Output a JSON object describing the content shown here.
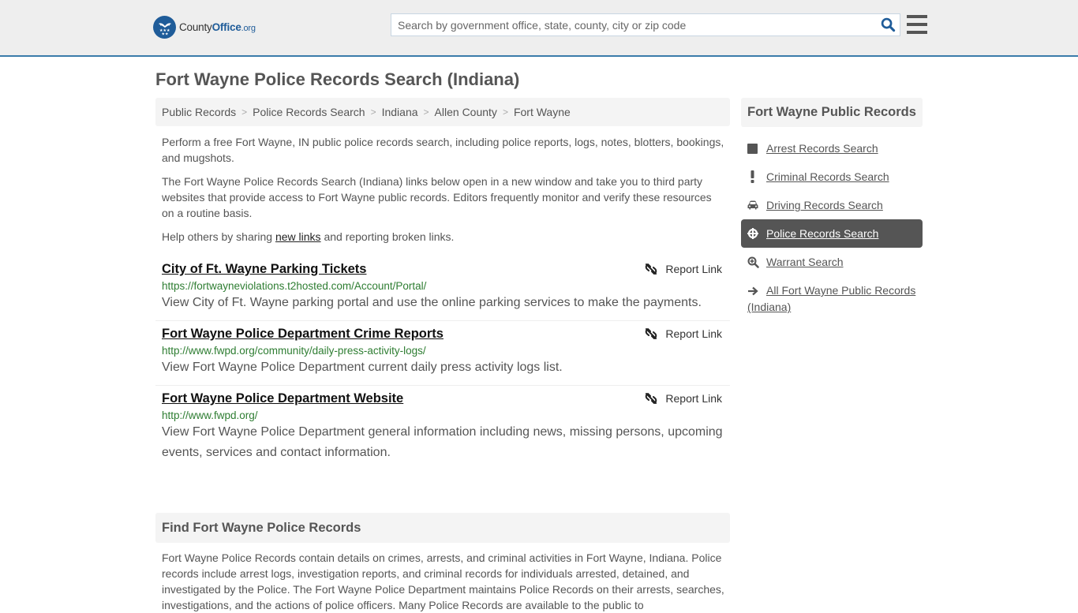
{
  "header": {
    "logo": {
      "name": "County",
      "name_accent": "Office",
      "tld": ".org",
      "brand_color": "#1f5c99"
    },
    "search": {
      "placeholder": "Search by government office, state, county, city or zip code",
      "value": ""
    },
    "icons": {
      "search": "search-icon",
      "menu": "hamburger-menu-icon"
    }
  },
  "page": {
    "title": "Fort Wayne Police Records Search (Indiana)",
    "breadcrumb": [
      {
        "label": "Public Records"
      },
      {
        "label": "Police Records Search"
      },
      {
        "label": "Indiana"
      },
      {
        "label": "Allen County"
      },
      {
        "label": "Fort Wayne"
      }
    ],
    "breadcrumb_separator": ">",
    "intro": {
      "p1": "Perform a free Fort Wayne, IN public police records search, including police reports, logs, notes, blotters, bookings, and mugshots.",
      "p2": "The Fort Wayne Police Records Search (Indiana) links below open in a new window and take you to third party websites that provide access to Fort Wayne public records. Editors frequently monitor and verify these resources on a routine basis.",
      "p3_before": "Help others by sharing ",
      "p3_link": "new links",
      "p3_after": " and reporting broken links."
    },
    "report_link_label": "Report Link",
    "links": [
      {
        "title": "City of Ft. Wayne Parking Tickets",
        "url": "https://fortwayneviolations.t2hosted.com/Account/Portal/",
        "description": "View City of Ft. Wayne parking portal and use the online parking services to make the payments."
      },
      {
        "title": "Fort Wayne Police Department Crime Reports",
        "url": "http://www.fwpd.org/community/daily-press-activity-logs/",
        "description": "View Fort Wayne Police Department current daily press activity logs list."
      },
      {
        "title": "Fort Wayne Police Department Website",
        "url": "http://www.fwpd.org/",
        "description": "View Fort Wayne Police Department general information including news, missing persons, upcoming events, services and contact information."
      }
    ],
    "find_section": {
      "heading": "Find Fort Wayne Police Records",
      "body": "Fort Wayne Police Records contain details on crimes, arrests, and criminal activities in Fort Wayne, Indiana. Police records include arrest logs, investigation reports, and criminal records for individuals arrested, detained, and investigated by the Police. The Fort Wayne Police Department maintains Police Records on their arrests, searches, investigations, and the actions of police officers. Many Police Records are available to the public to"
    }
  },
  "sidebar": {
    "title": "Fort Wayne Public Records",
    "items": [
      {
        "label": "Arrest Records Search",
        "icon": "square-icon",
        "active": false
      },
      {
        "label": "Criminal Records Search",
        "icon": "exclamation-icon",
        "active": false
      },
      {
        "label": "Driving Records Search",
        "icon": "car-icon",
        "active": false
      },
      {
        "label": "Police Records Search",
        "icon": "crosshairs-icon",
        "active": true
      },
      {
        "label": "Warrant Search",
        "icon": "search-plus-icon",
        "active": false
      },
      {
        "label": "All Fort Wayne Public Records (Indiana)",
        "icon": "arrow-right-icon",
        "active": false
      }
    ]
  },
  "colors": {
    "header_bg": "#eeeeee",
    "header_border": "#3a7caa",
    "url_green": "#2e7d32",
    "active_bg": "#555555",
    "panel_bg": "#f4f4f4"
  }
}
